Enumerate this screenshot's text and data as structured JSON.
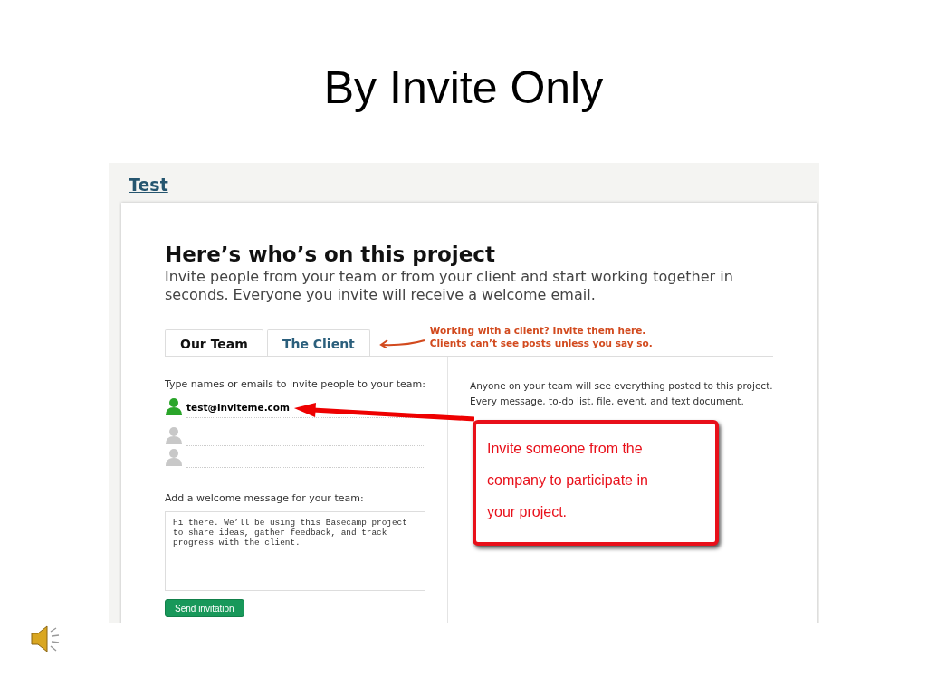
{
  "slide": {
    "title": "By Invite Only"
  },
  "project": {
    "name": "Test"
  },
  "panel": {
    "heading": "Here’s who’s on this project",
    "intro": "Invite people from your team or from your client and start working together in seconds. Everyone you invite will receive a welcome email.",
    "tabs": [
      {
        "label": "Our Team",
        "selected": true
      },
      {
        "label": "The Client",
        "selected": false
      }
    ],
    "tab_note": "Working with a client? Invite them here.\nClients can’t see posts unless you say so.",
    "invite_label": "Type names or emails to invite people to your team:",
    "invitees": [
      {
        "value": "test@inviteme.com",
        "filled": true
      },
      {
        "filled": false
      },
      {
        "filled": false
      }
    ],
    "message_label": "Add a welcome message for your team:",
    "message": "Hi there. We’ll be using this Basecamp project\nto share ideas, gather feedback, and track\nprogress with the client.",
    "send_button": "Send invitation",
    "info": "Anyone on your team will see everything posted to this project.\nEvery message, to-do list, file, event, and text document."
  },
  "callout": {
    "text": "Invite someone from the\ncompany to participate in\nyour project."
  }
}
